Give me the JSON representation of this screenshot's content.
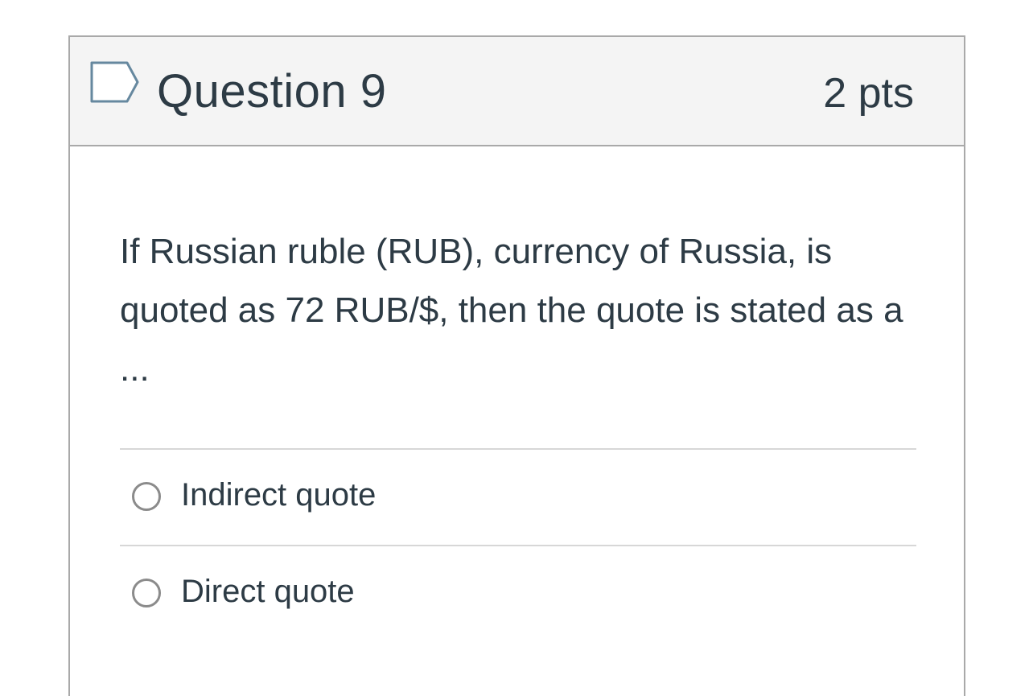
{
  "question": {
    "title": "Question 9",
    "points": "2 pts",
    "flag_icon": "flag-outline-icon",
    "text": "If Russian ruble (RUB), currency of Russia, is quoted as 72 RUB/$, then the quote is stated as a ..."
  },
  "answers": [
    {
      "label": "Indirect quote",
      "selected": false
    },
    {
      "label": "Direct quote",
      "selected": false
    }
  ],
  "colors": {
    "text": "#2d3b45",
    "header_bg": "#f4f4f4",
    "border": "#a9a9a9",
    "divider": "#d7d7d7",
    "flag": "#66889f"
  }
}
